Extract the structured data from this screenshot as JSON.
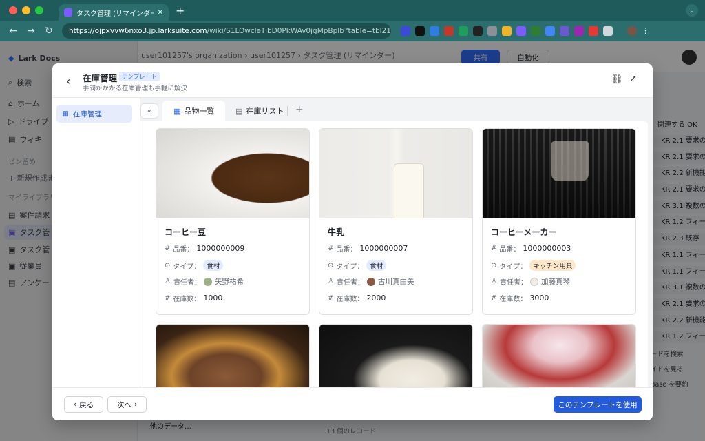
{
  "browser": {
    "tab_title": "タスク管理 (リマインダー) - Lar",
    "url_host": "https://ojpxvvw6nxo3.jp.larksuite.com",
    "url_path": "/wiki/S1LOwcleTibD0PkWAv0jgMpBplb?table=tbl21..."
  },
  "sidebar": {
    "brand": "Lark Docs",
    "search": "検索",
    "items": [
      "ホーム",
      "ドライブ",
      "ウィキ"
    ],
    "pinned": "ピン留め",
    "new": "+ 新規作成ま",
    "library": "マイライブラリ",
    "lib_items": [
      "案件請求",
      "タスク管",
      "タスク管",
      "従業員",
      "アンケー"
    ]
  },
  "topbar": {
    "crumb1": "user101257's organization",
    "crumb2": "user101257",
    "crumb3": "タスク管理 (リマインダー)",
    "share": "共有",
    "automate": "自動化"
  },
  "right_panel": {
    "header": "関連する OK",
    "krs": [
      "KR 2.1 要求の",
      "KR 2.1 要求の",
      "KR 2.2 新機能",
      "KR 2.1 要求の",
      "KR 3.1 複数の",
      "KR 1.2 フィー",
      "KR 2.3 既存",
      "KR 1.1 フィー",
      "KR 1.1 フィー",
      "KR 3.1 複数の",
      "KR 2.1 要求の",
      "KR 2.2 新機能",
      "KR 1.2 フィー"
    ],
    "links": [
      "ードを検索",
      "イドを見る",
      "Base を要約"
    ]
  },
  "bottom": {
    "other_data": "他のデータ…",
    "records": "13 個のレコード"
  },
  "modal": {
    "title": "在庫管理",
    "tag": "テンプレート",
    "subtitle": "手間がかかる在庫管理も手軽に解決",
    "left_item": "在庫管理",
    "tabs": [
      "品物一覧",
      "在庫リスト"
    ],
    "cards": [
      {
        "name": "コーヒー豆",
        "code_label": "品番：",
        "code": "1000000009",
        "type_label": "タイプ：",
        "type": "食材",
        "owner_label": "責任者：",
        "owner": "矢野祐希",
        "stock_label": "在庫数：",
        "stock": "1000"
      },
      {
        "name": "牛乳",
        "code_label": "品番：",
        "code": "1000000007",
        "type_label": "タイプ：",
        "type": "食材",
        "owner_label": "責任者：",
        "owner": "古川真由美",
        "stock_label": "在庫数：",
        "stock": "2000"
      },
      {
        "name": "コーヒーメーカー",
        "code_label": "品番：",
        "code": "1000000003",
        "type_label": "タイプ：",
        "type": "キッチン用具",
        "owner_label": "責任者：",
        "owner": "加藤真琴",
        "stock_label": "在庫数：",
        "stock": "3000"
      }
    ],
    "back_btn": "戻る",
    "next_btn": "次へ",
    "use_btn": "このテンプレートを使用"
  },
  "colors": {
    "accent": "#245bdb",
    "browser_frame": "#1e5b5a"
  }
}
